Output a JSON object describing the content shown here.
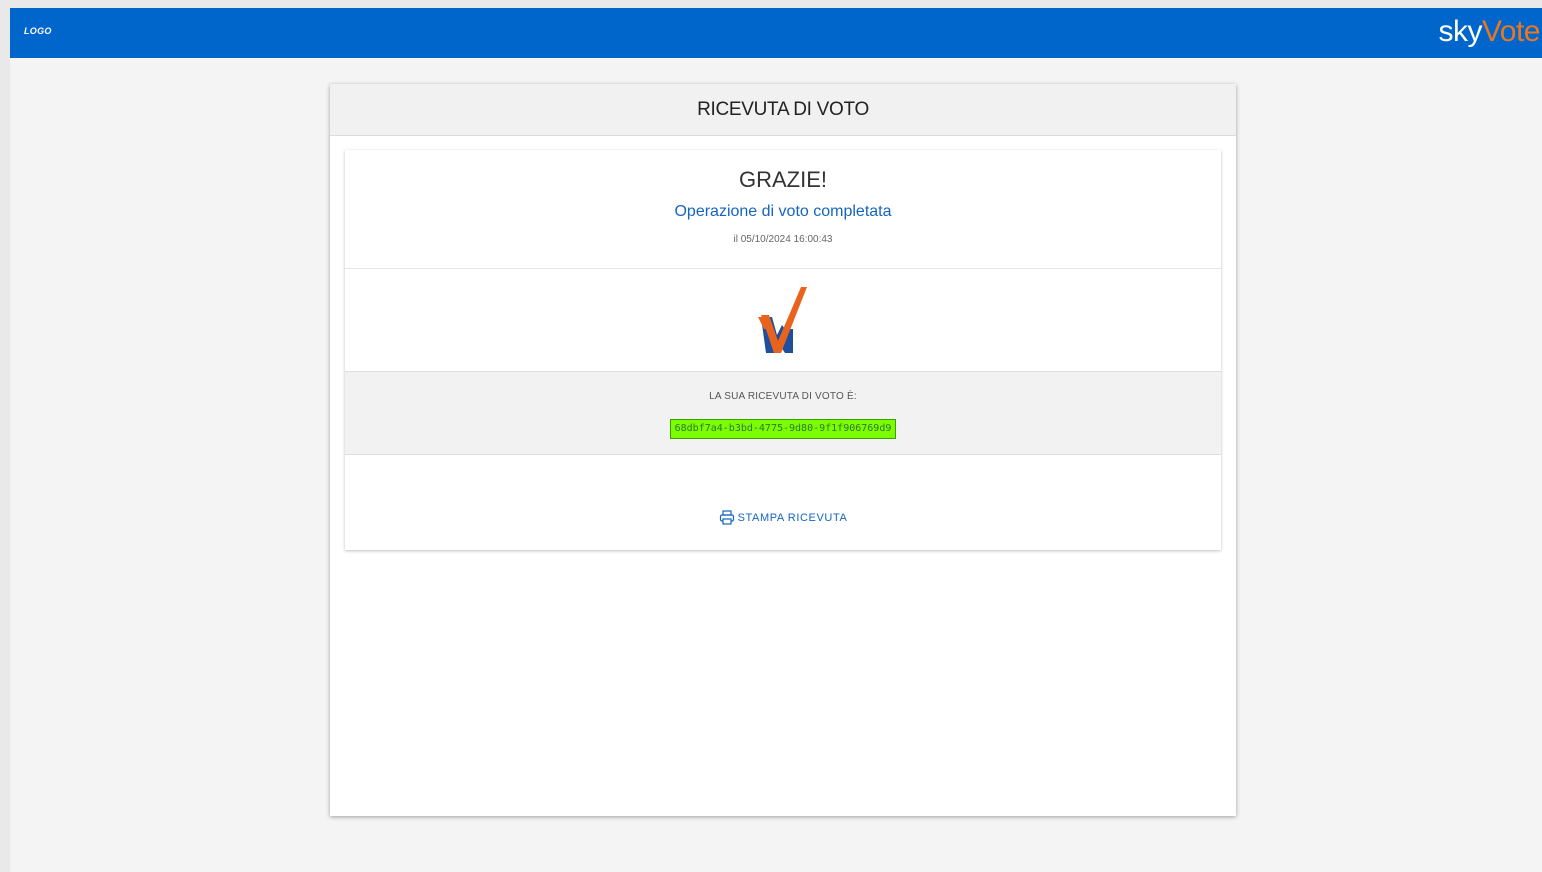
{
  "header": {
    "logo_text": "LOGO",
    "brand": {
      "part1": "sky",
      "part2": "Vote"
    }
  },
  "card": {
    "title": "RICEVUTA DI VOTO",
    "thanks": "GRAZIE!",
    "completed": "Operazione di voto completata",
    "timestamp": "il 05/10/2024 16:00:43",
    "receipt_label": "LA SUA RICEVUTA DI VOTO È:",
    "receipt_code": "68dbf7a4-b3bd-4775-9d80-9f1f906769d9",
    "print_label": "STAMPA RICEVUTA"
  },
  "icons": {
    "check": "checkmark-logo-icon",
    "print": "printer-icon"
  },
  "colors": {
    "topbar": "#0066cc",
    "accent_orange": "#e87722",
    "link_blue": "#1565c0",
    "receipt_highlight": "#7cfc00"
  }
}
